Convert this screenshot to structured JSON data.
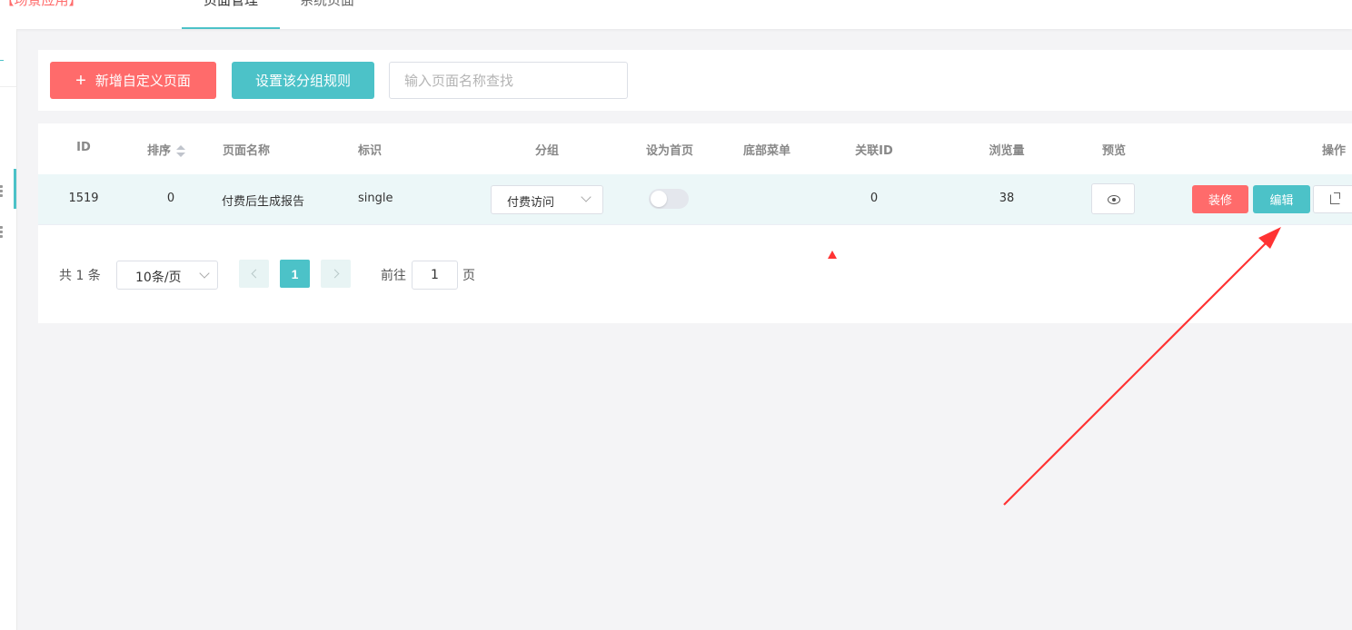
{
  "header": {
    "app_title_prefix": "I",
    "app_title": "【场景应用】",
    "tabs": [
      {
        "label": "页面管理"
      },
      {
        "label": "系统页面"
      }
    ]
  },
  "toolbar": {
    "add_label": "新增自定义页面",
    "rule_label": "设置该分组规则",
    "search_placeholder": "输入页面名称查找"
  },
  "table": {
    "columns": [
      "ID",
      "排序",
      "页面名称",
      "标识",
      "分组",
      "设为首页",
      "底部菜单",
      "关联ID",
      "浏览量",
      "预览",
      "操作"
    ],
    "rows": [
      {
        "id": "1519",
        "sort": "0",
        "name": "付费后生成报告",
        "tag": "single",
        "group": "付费访问",
        "home": false,
        "bottom_menu": "",
        "related_id": "0",
        "views": "38",
        "decorate_label": "装修",
        "edit_label": "编辑"
      }
    ]
  },
  "pagination": {
    "total": "共 1 条",
    "page_size": "10条/页",
    "current": "1",
    "goto_label": "前往",
    "goto_value": "1",
    "goto_suffix": "页"
  },
  "colors": {
    "accent": "#4cc2c8",
    "danger": "#ff6b6b",
    "annotation": "#ff3333"
  }
}
